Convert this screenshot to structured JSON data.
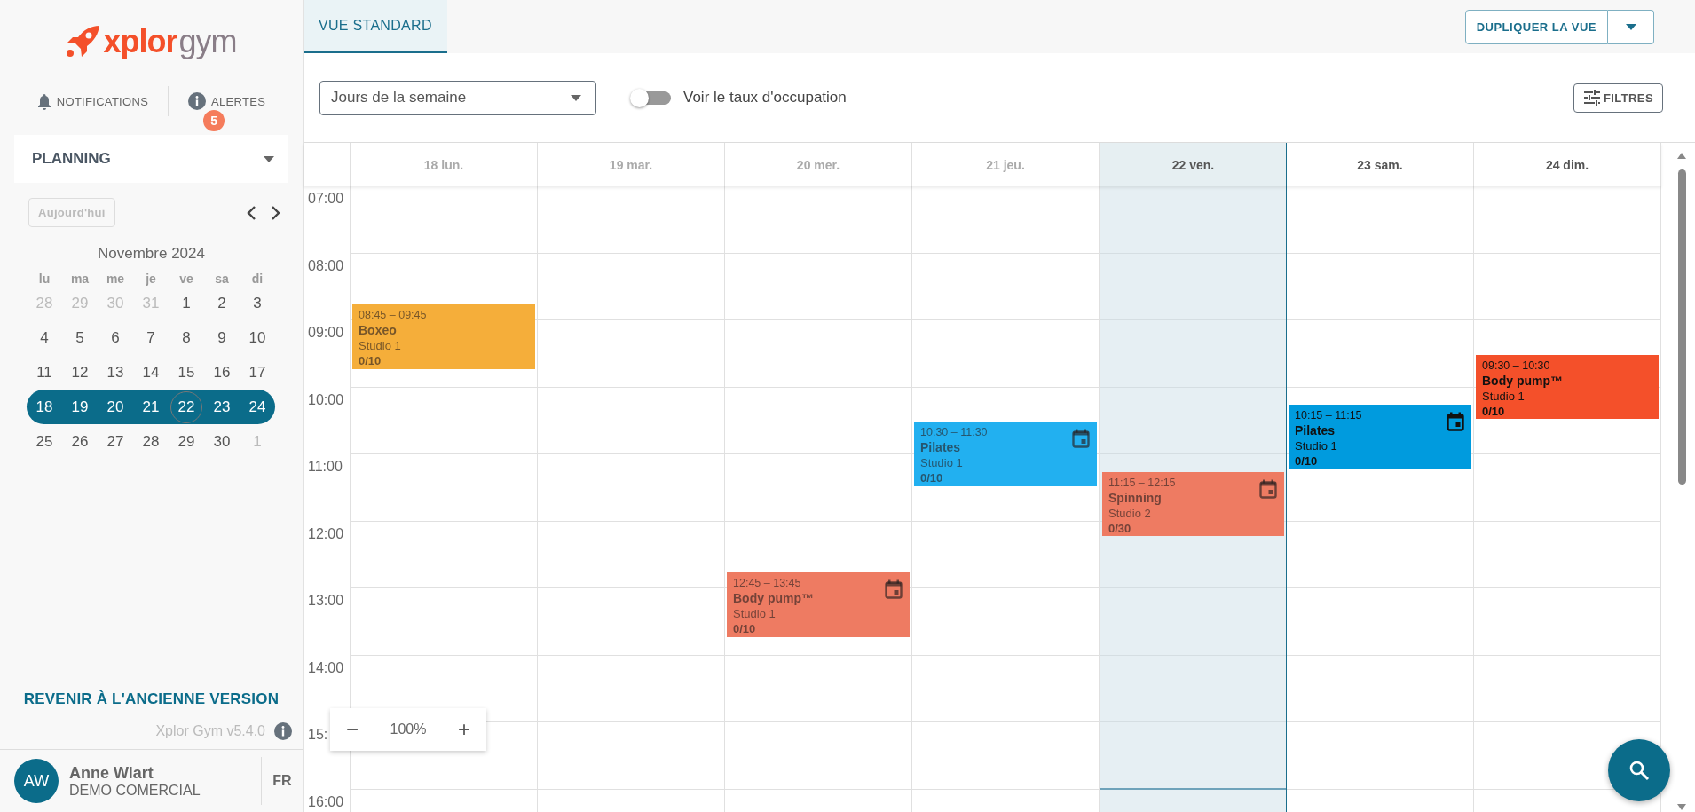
{
  "sidebar": {
    "logo": {
      "brand": "xplor",
      "product": "gym"
    },
    "notifications": {
      "label": "NOTIFICATIONS"
    },
    "alerts": {
      "label": "ALERTES",
      "badge": "5"
    },
    "menu": {
      "label": "PLANNING"
    },
    "today_button": {
      "label": "Aujourd'hui",
      "disabled": true
    },
    "mini_calendar": {
      "month": "Novembre 2024",
      "weekdays": [
        "lu",
        "ma",
        "me",
        "je",
        "ve",
        "sa",
        "di"
      ],
      "weeks": [
        {
          "selected": false,
          "days": [
            {
              "label": "28",
              "outside": true,
              "today": false
            },
            {
              "label": "29",
              "outside": true,
              "today": false
            },
            {
              "label": "30",
              "outside": true,
              "today": false
            },
            {
              "label": "31",
              "outside": true,
              "today": false
            },
            {
              "label": "1",
              "outside": false,
              "today": false
            },
            {
              "label": "2",
              "outside": false,
              "today": false
            },
            {
              "label": "3",
              "outside": false,
              "today": false
            }
          ]
        },
        {
          "selected": false,
          "days": [
            {
              "label": "4",
              "outside": false,
              "today": false
            },
            {
              "label": "5",
              "outside": false,
              "today": false
            },
            {
              "label": "6",
              "outside": false,
              "today": false
            },
            {
              "label": "7",
              "outside": false,
              "today": false
            },
            {
              "label": "8",
              "outside": false,
              "today": false
            },
            {
              "label": "9",
              "outside": false,
              "today": false
            },
            {
              "label": "10",
              "outside": false,
              "today": false
            }
          ]
        },
        {
          "selected": false,
          "days": [
            {
              "label": "11",
              "outside": false,
              "today": false
            },
            {
              "label": "12",
              "outside": false,
              "today": false
            },
            {
              "label": "13",
              "outside": false,
              "today": false
            },
            {
              "label": "14",
              "outside": false,
              "today": false
            },
            {
              "label": "15",
              "outside": false,
              "today": false
            },
            {
              "label": "16",
              "outside": false,
              "today": false
            },
            {
              "label": "17",
              "outside": false,
              "today": false
            }
          ]
        },
        {
          "selected": true,
          "days": [
            {
              "label": "18",
              "outside": false,
              "today": false
            },
            {
              "label": "19",
              "outside": false,
              "today": false
            },
            {
              "label": "20",
              "outside": false,
              "today": false
            },
            {
              "label": "21",
              "outside": false,
              "today": false
            },
            {
              "label": "22",
              "outside": false,
              "today": true
            },
            {
              "label": "23",
              "outside": false,
              "today": false
            },
            {
              "label": "24",
              "outside": false,
              "today": false
            }
          ]
        },
        {
          "selected": false,
          "days": [
            {
              "label": "25",
              "outside": false,
              "today": false
            },
            {
              "label": "26",
              "outside": false,
              "today": false
            },
            {
              "label": "27",
              "outside": false,
              "today": false
            },
            {
              "label": "28",
              "outside": false,
              "today": false
            },
            {
              "label": "29",
              "outside": false,
              "today": false
            },
            {
              "label": "30",
              "outside": false,
              "today": false
            },
            {
              "label": "1",
              "outside": true,
              "today": false
            }
          ]
        }
      ]
    },
    "old_version_link": "REVENIR À L'ANCIENNE VERSION",
    "version": "Xplor Gym v5.4.0",
    "user": {
      "initials": "AW",
      "name": "Anne Wiart",
      "organization": "DEMO COMERCIAL",
      "language": "FR"
    }
  },
  "tabs": [
    {
      "label": "VUE STANDARD",
      "selected": true
    }
  ],
  "duplicate_button": {
    "label": "DUPLIQUER LA VUE"
  },
  "view_select": {
    "value": "Jours de la semaine"
  },
  "occupancy_toggle": {
    "label": "Voir le taux d'occupation",
    "on": false
  },
  "filters_button": {
    "label": "FILTRES"
  },
  "calendar": {
    "time_rows": [
      "07:00",
      "08:00",
      "09:00",
      "10:00",
      "11:00",
      "12:00",
      "13:00",
      "14:00",
      "15:",
      "16:00"
    ],
    "now_line": {
      "level": 0.9
    },
    "days": [
      {
        "label": "18 lun.",
        "past": true,
        "today": false,
        "events": [
          {
            "time": "08:45 – 09:45",
            "title": "Boxeo",
            "room": "Studio 1",
            "capacity": "0/10",
            "color": "#f5ae3a",
            "faded": true,
            "icon": false
          }
        ]
      },
      {
        "label": "19 mar.",
        "past": true,
        "today": false
      },
      {
        "label": "20 mer.",
        "past": true,
        "today": false,
        "events": [
          {
            "time": "12:45 – 13:45",
            "title": "Body pump™",
            "room": "Studio 1",
            "capacity": "0/10",
            "color": "#ee7b62",
            "faded": true,
            "icon": true
          }
        ]
      },
      {
        "label": "21 jeu.",
        "past": true,
        "today": false,
        "events": [
          {
            "time": "10:30 – 11:30",
            "title": "Pilates",
            "room": "Studio 1",
            "capacity": "0/10",
            "color": "#22b0f0",
            "faded": true,
            "icon": true
          }
        ]
      },
      {
        "label": "22 ven.",
        "past": false,
        "today": true,
        "events": [
          {
            "time": "11:15 – 12:15",
            "title": "Spinning",
            "room": "Studio 2",
            "capacity": "0/30",
            "color": "#ee7b62",
            "faded": true,
            "icon": true
          }
        ]
      },
      {
        "label": "23 sam.",
        "past": false,
        "today": false,
        "events": [
          {
            "time": "10:15 – 11:15",
            "title": "Pilates",
            "room": "Studio 1",
            "capacity": "0/10",
            "color": "#009bde",
            "faded": false,
            "icon": true
          }
        ]
      },
      {
        "label": "24 dim.",
        "past": false,
        "today": false,
        "events": [
          {
            "time": "09:30 – 10:30",
            "title": "Body pump™",
            "room": "Studio 1",
            "capacity": "0/10",
            "color": "#f4502a",
            "faded": false,
            "icon": false
          }
        ]
      }
    ]
  },
  "zoom_control": {
    "minus": "−",
    "value": "100%",
    "plus": "+"
  }
}
